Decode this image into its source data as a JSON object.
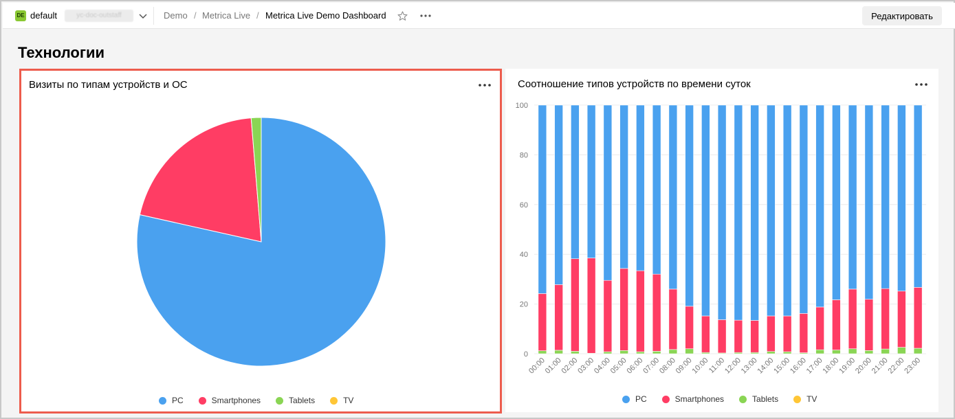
{
  "topbar": {
    "workspace_badge": "DE",
    "workspace_name": "default",
    "workspace_tenant": "yc-doc-outstaff",
    "breadcrumbs": [
      "Demo",
      "Metrica Live",
      "Metrica Live Demo Dashboard"
    ],
    "edit_label": "Редактировать"
  },
  "section": {
    "title": "Технологии"
  },
  "colors": {
    "PC": "#4aa1ef",
    "Smartphones": "#ff3d64",
    "Tablets": "#8ad554",
    "TV": "#ffc636",
    "accent_border": "#ed5c4d"
  },
  "widgets": {
    "pie": {
      "title": "Визиты по типам устройств и ОС",
      "legend": [
        "PC",
        "Smartphones",
        "Tablets",
        "TV"
      ]
    },
    "bars": {
      "title": "Соотношение типов устройств по времени суток",
      "legend": [
        "PC",
        "Smartphones",
        "Tablets",
        "TV"
      ]
    }
  },
  "chart_data": [
    {
      "type": "pie",
      "title": "Визиты по типам устройств и ОС",
      "categories": [
        "PC",
        "Smartphones",
        "Tablets",
        "TV"
      ],
      "values": [
        78.5,
        20.2,
        1.3,
        0.0
      ],
      "legend": "bottom"
    },
    {
      "type": "bar",
      "stacked": true,
      "normalized": true,
      "title": "Соотношение типов устройств по времени суток",
      "categories": [
        "00:00",
        "01:00",
        "02:00",
        "03:00",
        "04:00",
        "05:00",
        "06:00",
        "07:00",
        "08:00",
        "09:00",
        "10:00",
        "11:00",
        "12:00",
        "13:00",
        "14:00",
        "15:00",
        "16:00",
        "17:00",
        "18:00",
        "19:00",
        "20:00",
        "21:00",
        "22:00",
        "23:00"
      ],
      "series": [
        {
          "name": "Tablets",
          "values": [
            1.2,
            1.4,
            1.0,
            0.2,
            0.8,
            1.3,
            0.8,
            1.0,
            1.7,
            2.0,
            0.5,
            0.3,
            0.5,
            0.5,
            0.9,
            0.8,
            0.4,
            1.6,
            1.5,
            2.0,
            1.3,
            1.9,
            2.6,
            2.2
          ]
        },
        {
          "name": "Smartphones",
          "values": [
            23.0,
            26.4,
            37.2,
            38.3,
            28.7,
            33.0,
            32.6,
            31.0,
            24.3,
            17.1,
            14.7,
            13.4,
            13.0,
            12.9,
            14.3,
            14.4,
            15.8,
            17.2,
            20.2,
            24.0,
            20.6,
            24.3,
            22.6,
            24.5
          ]
        },
        {
          "name": "PC",
          "values": [
            75.8,
            72.2,
            61.8,
            61.5,
            70.5,
            65.7,
            66.6,
            68.0,
            74.0,
            80.9,
            84.8,
            86.3,
            86.5,
            86.6,
            84.8,
            84.8,
            83.8,
            81.2,
            78.3,
            74.0,
            78.1,
            73.8,
            74.8,
            73.3
          ]
        },
        {
          "name": "TV",
          "values": [
            0,
            0,
            0,
            0,
            0,
            0,
            0,
            0,
            0,
            0,
            0,
            0,
            0,
            0,
            0,
            0,
            0,
            0,
            0,
            0,
            0,
            0,
            0,
            0
          ]
        }
      ],
      "ylim": [
        0,
        100
      ],
      "yticks": [
        "0",
        "20",
        "40",
        "60",
        "80",
        "100"
      ],
      "legend": "bottom",
      "grid": true
    }
  ]
}
